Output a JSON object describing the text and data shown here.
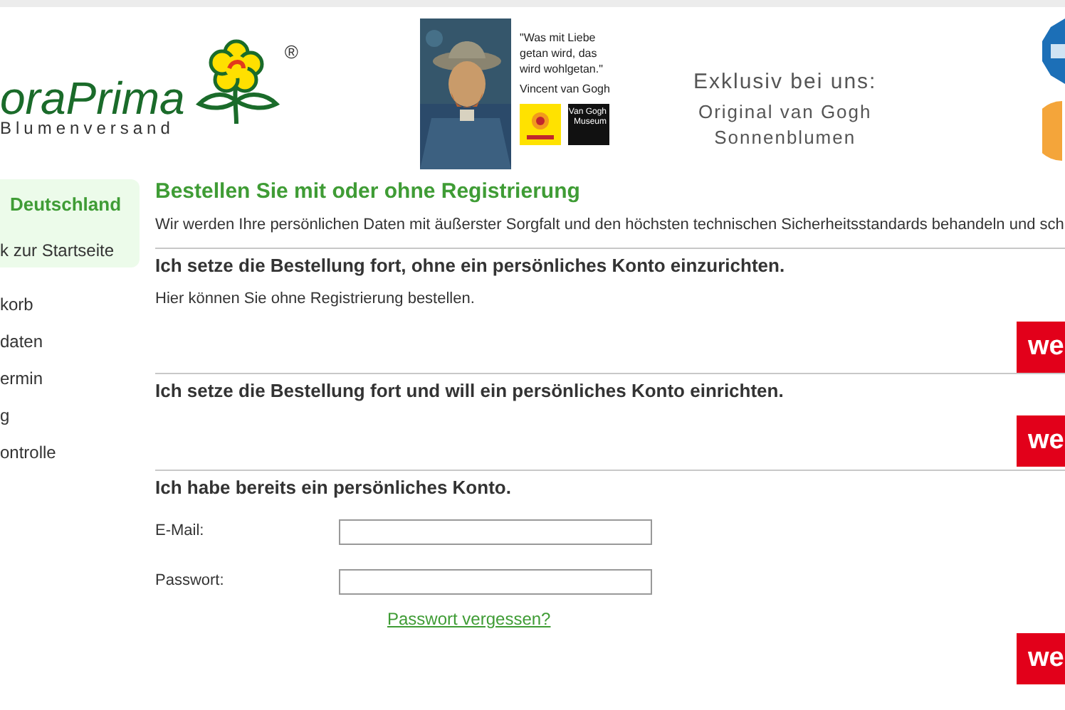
{
  "header": {
    "logo_text": "oraPrima",
    "logo_mark": "®",
    "logo_tagline": "Blumenversand",
    "quote": "\"Was mit Liebe getan wird, das wird wohlgetan.\"",
    "quote_author": "Vincent van Gogh",
    "museum_badge": "Van Gogh Museum",
    "promo_title": "Exklusiv bei uns:",
    "promo_lines": [
      "Original van Gogh",
      "Sonnenblumen"
    ]
  },
  "sidebar": {
    "country": "Deutschland",
    "back_link": "k zur Startseite",
    "steps": [
      {
        "label": "korb"
      },
      {
        "label": "daten"
      },
      {
        "label": "ermin"
      },
      {
        "label": "g"
      },
      {
        "label": "ontrolle"
      }
    ]
  },
  "main": {
    "title": "Bestellen Sie mit oder ohne Registrierung",
    "intro": "Wir werden Ihre persönlichen Daten mit äußerster Sorgfalt und den höchsten technischen Sicherheitsstandards behandeln und sch",
    "sections": [
      {
        "kind": "guest",
        "heading": "Ich setze die Bestellung fort, ohne ein persönliches Konto einzurichten.",
        "text": "Hier können Sie ohne Registrierung bestellen.",
        "button": "we"
      },
      {
        "kind": "register",
        "heading": "Ich setze die Bestellung fort und will ein persönliches Konto einrichten.",
        "button": "we"
      },
      {
        "kind": "login",
        "heading": "Ich habe bereits ein persönliches Konto.",
        "fields": [
          {
            "label": "E-Mail:"
          },
          {
            "label": "Passwort:"
          }
        ],
        "link": "Passwort vergessen?",
        "button": "we"
      }
    ]
  }
}
